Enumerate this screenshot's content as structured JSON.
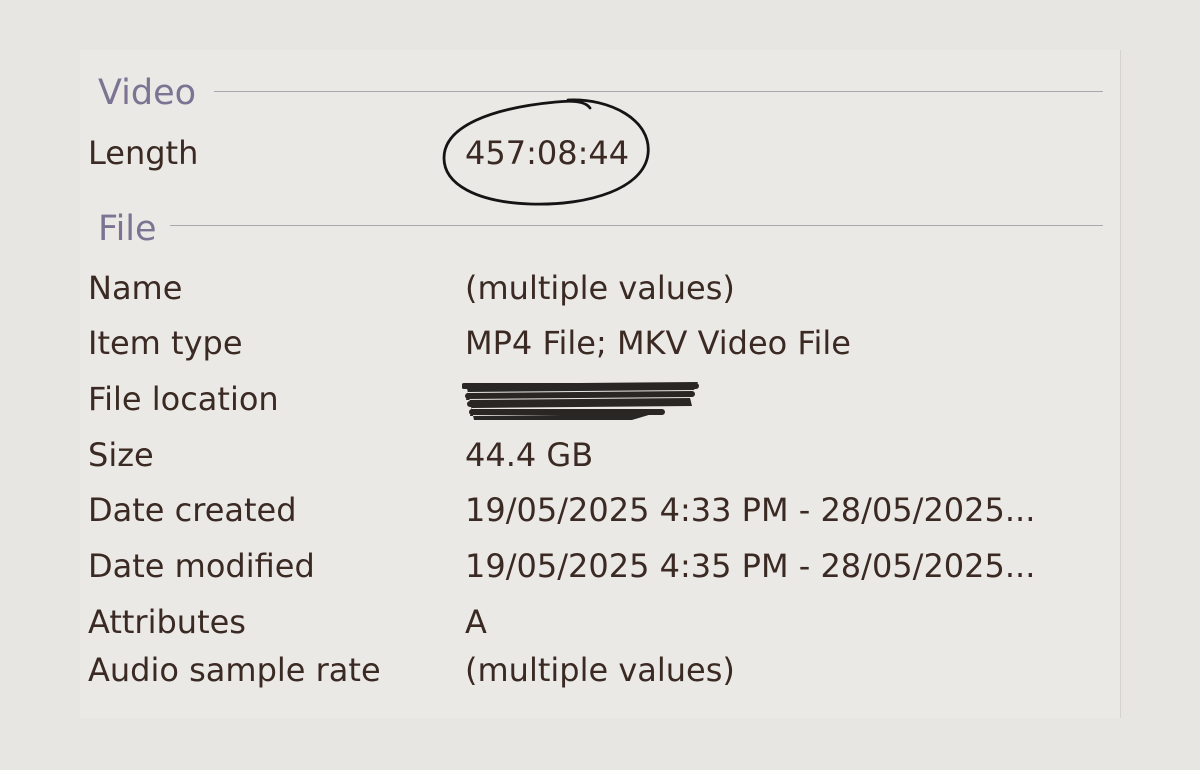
{
  "video_section": {
    "heading": "Video",
    "length_label": "Length",
    "length_value": "457:08:44"
  },
  "file_section": {
    "heading": "File",
    "rows": [
      {
        "label": "Name",
        "value": "(multiple values)"
      },
      {
        "label": "Item type",
        "value": "MP4 File; MKV Video File"
      },
      {
        "label": "File location",
        "value": ""
      },
      {
        "label": "Size",
        "value": "44.4 GB"
      },
      {
        "label": "Date created",
        "value": "19/05/2025 4:33 PM - 28/05/2025..."
      },
      {
        "label": "Date modified",
        "value": "19/05/2025 4:35 PM - 28/05/2025..."
      },
      {
        "label": "Attributes",
        "value": "A"
      },
      {
        "label": "Audio sample rate",
        "value": "(multiple values)"
      }
    ]
  },
  "colors": {
    "heading": "#7b7493",
    "text": "#3b2a24",
    "background": "#e8e6e2"
  }
}
